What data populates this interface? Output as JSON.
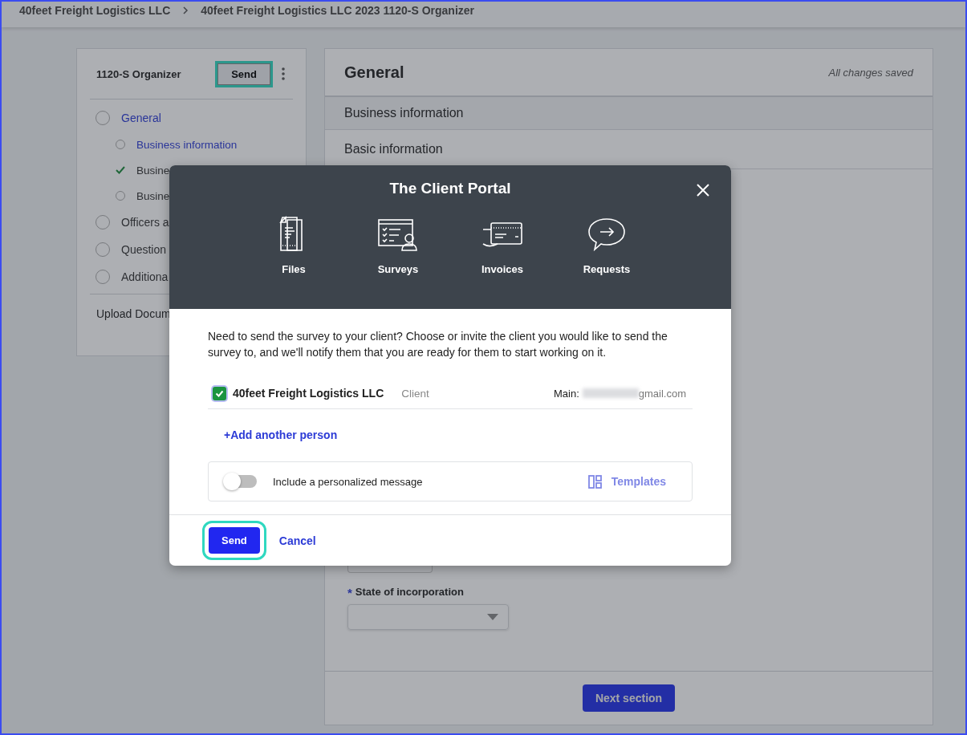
{
  "breadcrumb": [
    "40feet Freight Logistics LLC",
    "40feet Freight Logistics LLC 2023 1120-S Organizer"
  ],
  "sidebar": {
    "title": "1120-S Organizer",
    "send_button": "Send",
    "items": [
      {
        "label": "General",
        "selected": true,
        "done": false,
        "children": [
          {
            "label": "Business information",
            "selected": true,
            "done": false
          },
          {
            "label": "Busine",
            "selected": false,
            "done": true
          },
          {
            "label": "Busine",
            "selected": false,
            "done": false
          }
        ]
      },
      {
        "label": "Officers a",
        "selected": false,
        "done": false
      },
      {
        "label": "Question",
        "selected": false,
        "done": false
      },
      {
        "label": "Additiona",
        "selected": false,
        "done": false
      }
    ],
    "footer_link": "Upload Docum"
  },
  "main": {
    "title": "General",
    "save_status": "All changes saved",
    "section": "Business information",
    "subsection": "Basic information",
    "field_label": "State of incorporation",
    "required_mark": "*",
    "next_button": "Next section"
  },
  "modal": {
    "title": "The Client Portal",
    "features": [
      {
        "kind": "files",
        "label": "Files"
      },
      {
        "kind": "surveys",
        "label": "Surveys"
      },
      {
        "kind": "invoices",
        "label": "Invoices"
      },
      {
        "kind": "requests",
        "label": "Requests"
      }
    ],
    "message": "Need to send the survey to your client? Choose or invite the client you would like to send the survey to, and we'll notify them that you are ready for them to start working on it.",
    "recipients": [
      {
        "name": "40feet Freight Logistics LLC",
        "role": "Client",
        "email_label": "Main:",
        "email_visible": "gmail.com",
        "checked": true
      }
    ],
    "add_person": "+Add another person",
    "toggle": {
      "label": "Include a personalized message",
      "on": false
    },
    "templates": "Templates",
    "send_button": "Send",
    "cancel_button": "Cancel"
  }
}
